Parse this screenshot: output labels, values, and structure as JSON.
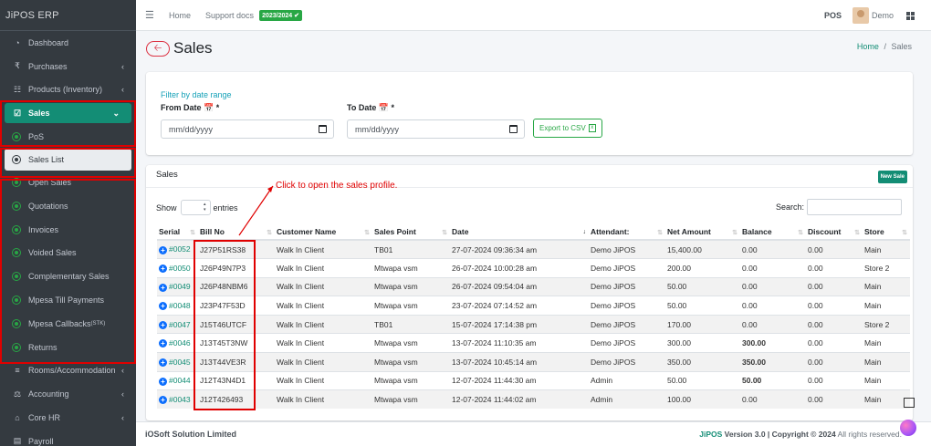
{
  "brand": "JiPOS ERP",
  "sidebar": {
    "items": [
      {
        "label": "Dashboard",
        "icon": "dashboard-icon",
        "glyph": "◔",
        "chev": ""
      },
      {
        "label": "Purchases",
        "icon": "rupee-icon",
        "glyph": "₹",
        "chev": "‹"
      },
      {
        "label": "Products (Inventory)",
        "icon": "table-icon",
        "glyph": "☷",
        "chev": "‹"
      },
      {
        "label": "Sales",
        "icon": "cart-icon",
        "glyph": "☑",
        "chev": "⌄"
      },
      {
        "label": "PoS"
      },
      {
        "label": "Sales List"
      },
      {
        "label": "Open Sales"
      },
      {
        "label": "Quotations"
      },
      {
        "label": "Invoices"
      },
      {
        "label": "Voided Sales"
      },
      {
        "label": "Complementary Sales"
      },
      {
        "label": "Mpesa Till Payments"
      },
      {
        "label": "Mpesa Callbacks",
        "suffix": "(STK)"
      },
      {
        "label": "Returns"
      },
      {
        "label": "Rooms/Accommodation",
        "icon": "bed-icon",
        "glyph": "≡",
        "chev": "‹"
      },
      {
        "label": "Accounting",
        "icon": "scale-icon",
        "glyph": "⚖",
        "chev": "‹"
      },
      {
        "label": "Core HR",
        "icon": "bank-icon",
        "glyph": "⌂",
        "chev": "‹"
      },
      {
        "label": "Payroll",
        "icon": "money-icon",
        "glyph": "▤",
        "chev": ""
      }
    ]
  },
  "topbar": {
    "home": "Home",
    "support": "Support docs",
    "year_badge": "2023/2024 ✔",
    "pos": "POS",
    "user": "Demo"
  },
  "page": {
    "title": "Sales",
    "breadcrumb_home": "Home",
    "breadcrumb_sep": "/",
    "breadcrumb_current": "Sales"
  },
  "filter": {
    "title": "Filter by date range",
    "from_label": "From Date 📅 *",
    "to_label": "To Date 📅 *",
    "from_value": "mm/dd/yyyy",
    "to_value": "mm/dd/yyyy",
    "export": "Export to CSV"
  },
  "sales": {
    "title": "Sales",
    "new_sale": "New Sale",
    "show": "Show",
    "entries": "entries",
    "search": "Search:",
    "annotation": "Click to open the sales profile.",
    "columns": [
      "Serial",
      "Bill No",
      "Customer Name",
      "Sales Point",
      "Date",
      "Attendant:",
      "Net Amount",
      "Balance",
      "Discount",
      "Store"
    ],
    "rows": [
      [
        "#0052",
        "J27P51RS38",
        "Walk In Client",
        "TB01",
        "27-07-2024 09:36:34 am",
        "Demo JiPOS",
        "15,400.00",
        "0.00",
        "0.00",
        "Main"
      ],
      [
        "#0050",
        "J26P49N7P3",
        "Walk In Client",
        "Mtwapa vsm",
        "26-07-2024 10:00:28 am",
        "Demo JiPOS",
        "200.00",
        "0.00",
        "0.00",
        "Store 2"
      ],
      [
        "#0049",
        "J26P48NBM6",
        "Walk In Client",
        "Mtwapa vsm",
        "26-07-2024 09:54:04 am",
        "Demo JiPOS",
        "50.00",
        "0.00",
        "0.00",
        "Main"
      ],
      [
        "#0048",
        "J23P47F53D",
        "Walk In Client",
        "Mtwapa vsm",
        "23-07-2024 07:14:52 am",
        "Demo JiPOS",
        "50.00",
        "0.00",
        "0.00",
        "Main"
      ],
      [
        "#0047",
        "J15T46UTCF",
        "Walk In Client",
        "TB01",
        "15-07-2024 17:14:38 pm",
        "Demo JiPOS",
        "170.00",
        "0.00",
        "0.00",
        "Store 2"
      ],
      [
        "#0046",
        "J13T45T3NW",
        "Walk In Client",
        "Mtwapa vsm",
        "13-07-2024 11:10:35 am",
        "Demo JiPOS",
        "300.00",
        "300.00",
        "0.00",
        "Main"
      ],
      [
        "#0045",
        "J13T44VE3R",
        "Walk In Client",
        "Mtwapa vsm",
        "13-07-2024 10:45:14 am",
        "Demo JiPOS",
        "350.00",
        "350.00",
        "0.00",
        "Main"
      ],
      [
        "#0044",
        "J12T43N4D1",
        "Walk In Client",
        "Mtwapa vsm",
        "12-07-2024 11:44:30 am",
        "Admin",
        "50.00",
        "50.00",
        "0.00",
        "Main"
      ],
      [
        "#0043",
        "J12T426493",
        "Walk In Client",
        "Mtwapa vsm",
        "12-07-2024 11:44:02 am",
        "Admin",
        "100.00",
        "0.00",
        "0.00",
        "Main"
      ]
    ]
  },
  "footer": {
    "company": "iOSoft Solution Limited",
    "version_brand": "JiPOS",
    "version": "Version 3.0",
    "copyright": "| Copyright © 2024",
    "rights": "All rights reserved."
  },
  "colors": {
    "accent": "#138d75",
    "annotation": "#e00000",
    "negative": "#dc3545"
  }
}
